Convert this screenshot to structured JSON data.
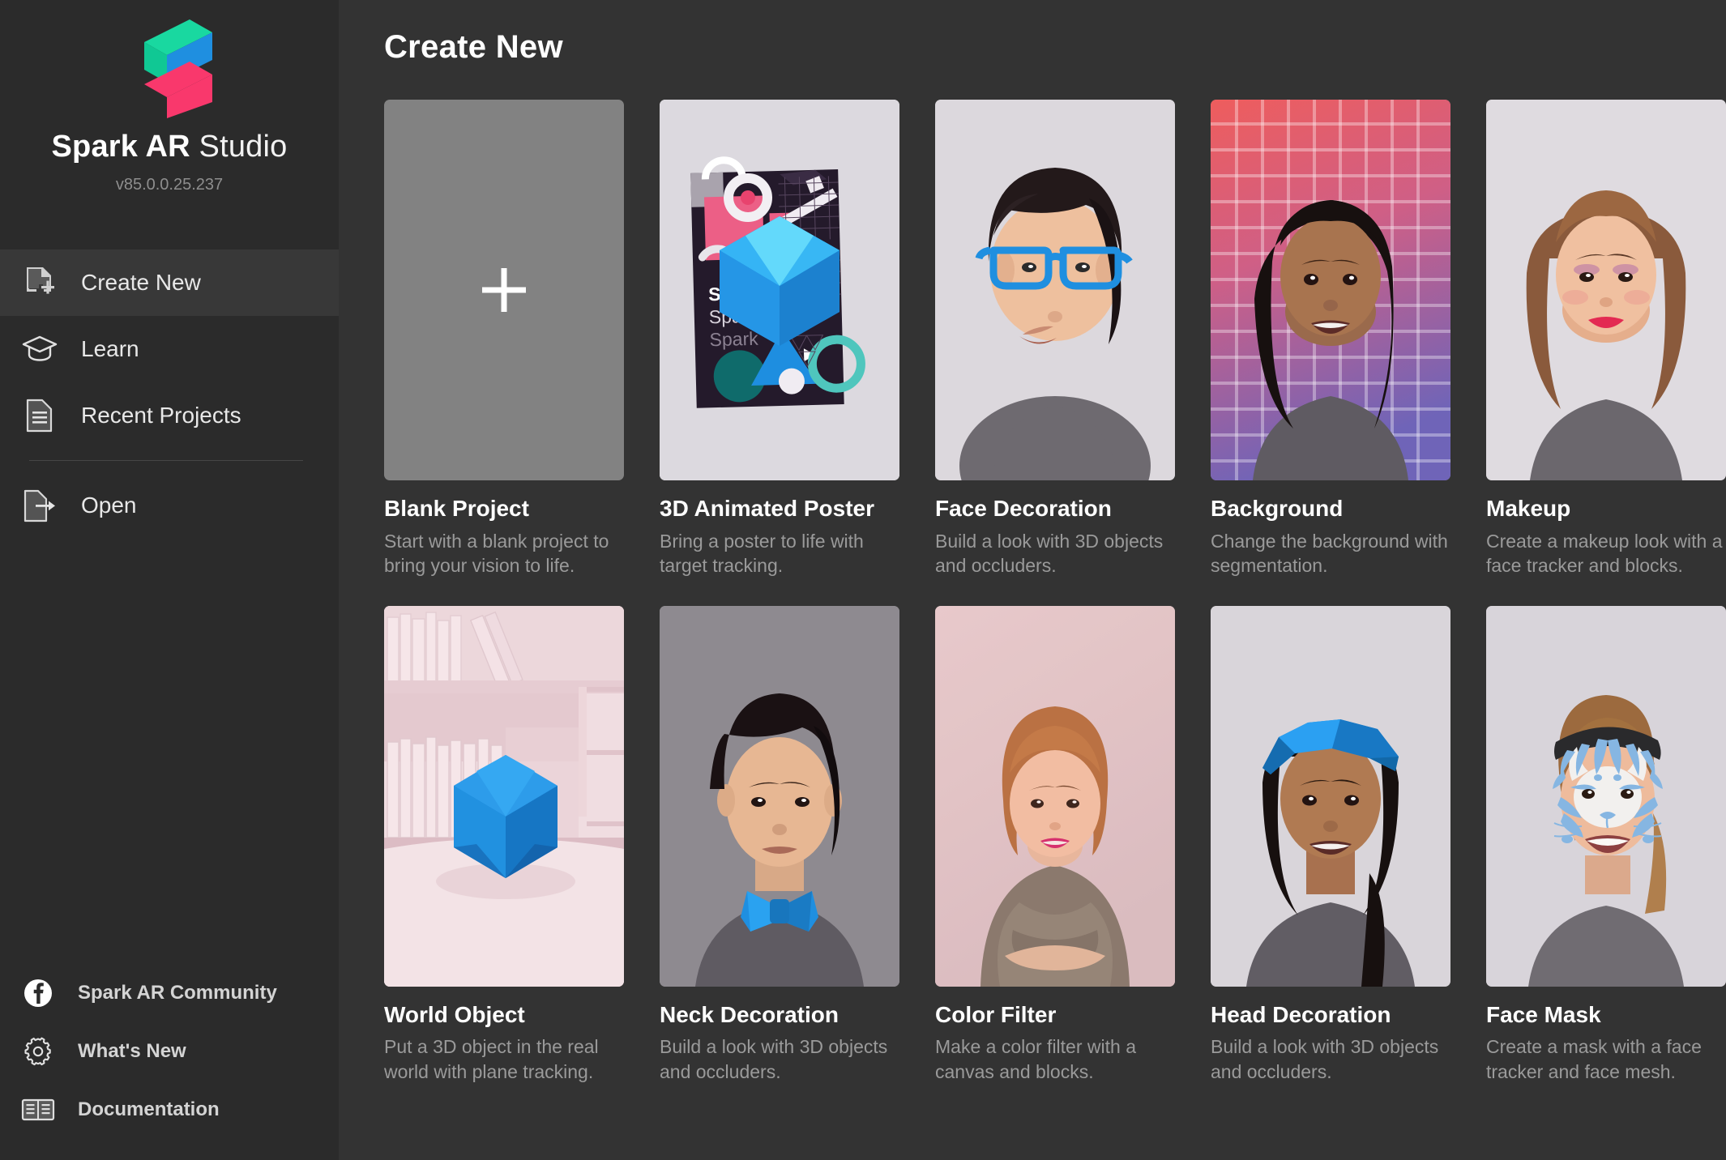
{
  "brand": {
    "name_bold": "Spark AR",
    "name_light": " Studio",
    "version": "v85.0.0.25.237",
    "logo_colors": {
      "top": "#19d8a0",
      "middle": "#1f8fe0",
      "bottom": "#f9386c"
    }
  },
  "sidebar": {
    "items": [
      {
        "label": "Create New",
        "icon": "document-plus-icon",
        "active": true
      },
      {
        "label": "Learn",
        "icon": "graduation-cap-icon",
        "active": false
      },
      {
        "label": "Recent Projects",
        "icon": "document-lines-icon",
        "active": false
      },
      {
        "label": "Open",
        "icon": "document-arrow-icon",
        "active": false
      }
    ],
    "links": [
      {
        "label": "Spark AR Community",
        "icon": "facebook-icon"
      },
      {
        "label": "What's New",
        "icon": "gear-icon"
      },
      {
        "label": "Documentation",
        "icon": "book-icon"
      }
    ]
  },
  "main": {
    "title": "Create New",
    "cards": [
      {
        "title": "Blank Project",
        "desc": "Start with a blank project to bring your vision to life.",
        "thumb": "blank-plus"
      },
      {
        "title": "3D Animated Poster",
        "desc": "Bring a poster to life with target tracking.",
        "thumb": "poster"
      },
      {
        "title": "Face Decoration",
        "desc": "Build a look with 3D objects and occluders.",
        "thumb": "glasses-man"
      },
      {
        "title": "Background",
        "desc": "Change the background with segmentation.",
        "thumb": "grid-woman"
      },
      {
        "title": "Makeup",
        "desc": "Create a makeup look with a face tracker and blocks.",
        "thumb": "makeup-woman"
      },
      {
        "title": "World Object",
        "desc": "Put a 3D object in the real world with plane tracking.",
        "thumb": "shelf-icosahedron"
      },
      {
        "title": "Neck Decoration",
        "desc": "Build a look with 3D objects and occluders.",
        "thumb": "bowtie-man"
      },
      {
        "title": "Color Filter",
        "desc": "Make a color filter with a canvas and blocks.",
        "thumb": "filter-woman"
      },
      {
        "title": "Head Decoration",
        "desc": "Build a look with 3D objects and occluders.",
        "thumb": "bandana-woman"
      },
      {
        "title": "Face Mask",
        "desc": "Create a mask with a face tracker and face mesh.",
        "thumb": "facepaint-woman"
      }
    ],
    "poster_text": [
      "Spark",
      "Spark",
      "Spark"
    ]
  },
  "colors": {
    "accent_blue": "#1f8fe0",
    "sidebar_bg": "#2b2b2b",
    "main_bg": "#333333",
    "active_item_bg": "#383838"
  }
}
